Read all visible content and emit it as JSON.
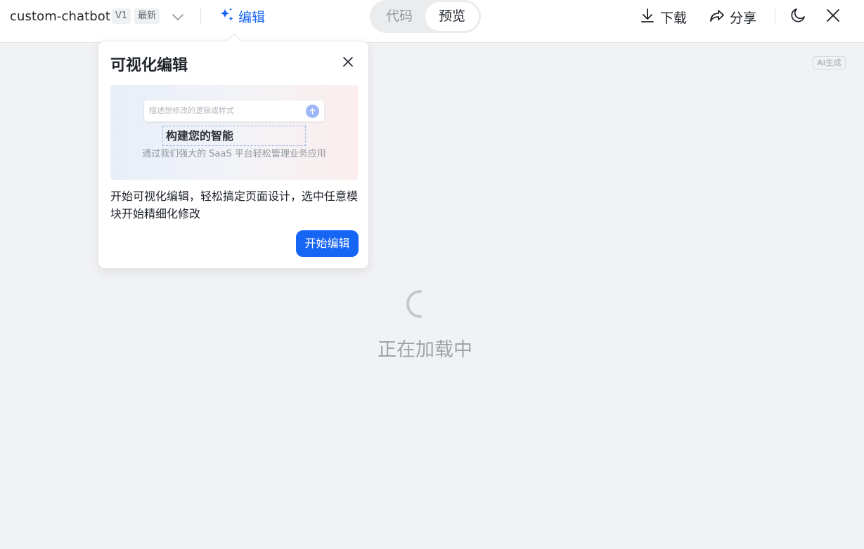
{
  "header": {
    "app_title": "custom-chatbot",
    "version_badge": "V1",
    "latest_badge": "最新",
    "edit_label": "编辑",
    "view_toggle": {
      "code_label": "代码",
      "preview_label": "预览",
      "selected": "预览"
    },
    "download_label": "下载",
    "share_label": "分享"
  },
  "ai_tag": "AI生成",
  "popover": {
    "title": "可视化编辑",
    "preview": {
      "input_placeholder": "描述想修改的逻辑或样式",
      "heading": "构建您的智能",
      "subtitle": "通过我们强大的 SaaS 平台轻松管理业务应用"
    },
    "description": "开始可视化编辑，轻松搞定页面设计，选中任意模块开始精细化修改",
    "cta_label": "开始编辑"
  },
  "loading_text": "正在加载中",
  "colors": {
    "accent": "#1665f5",
    "background": "#f1f2f4"
  },
  "icons": {
    "edit": "sparkle-icon",
    "version_dropdown": "chevron-down-icon",
    "download": "download-icon",
    "share": "share-icon",
    "theme": "moon-icon",
    "close": "close-icon"
  }
}
